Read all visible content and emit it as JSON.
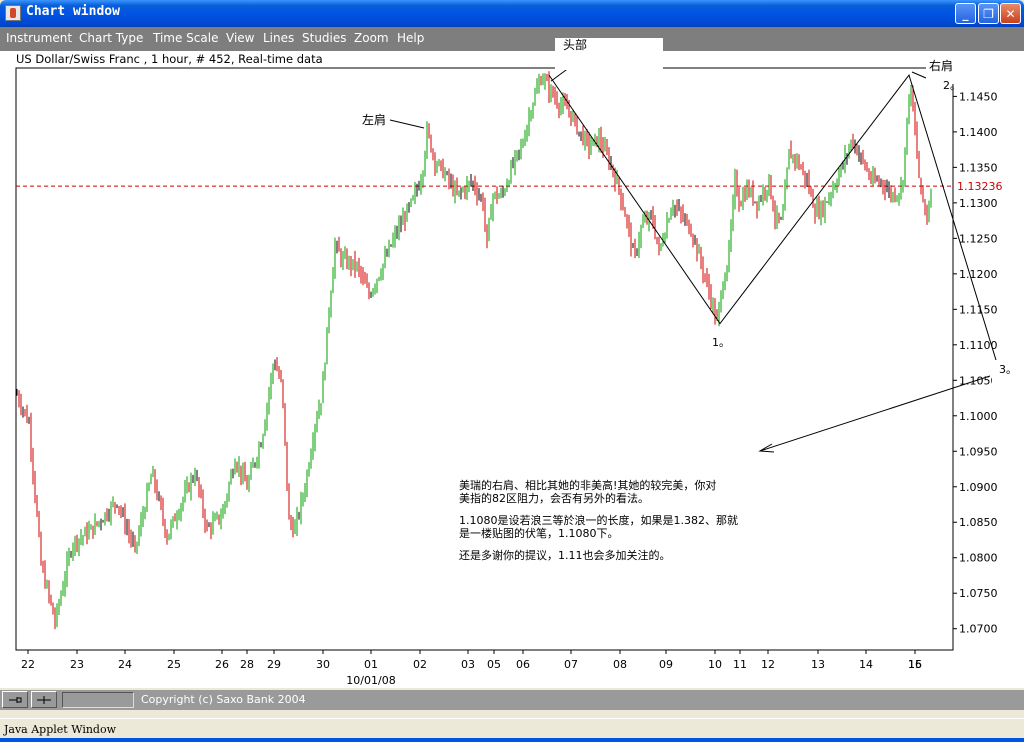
{
  "window": {
    "title": "Chart window",
    "buttons": [
      "_",
      "❐",
      "✕"
    ]
  },
  "menu": [
    "Instrument",
    "Chart Type",
    "Time Scale",
    "View",
    "Lines",
    "Studies",
    "Zoom",
    "Help"
  ],
  "chart_header": "US Dollar/Swiss Franc , 1 hour, # 452, Real-time data",
  "chart_data": {
    "type": "candlestick",
    "instrument": "US Dollar/Swiss Franc",
    "timeframe": "1 hour",
    "ylim": [
      1.067,
      1.149
    ],
    "y_ticks": [
      "1.1450",
      "1.1400",
      "1.1350",
      "1.1300",
      "1.1250",
      "1.1200",
      "1.1150",
      "1.1100",
      "1.1050",
      "1.1000",
      "1.0950",
      "1.0900",
      "1.0850",
      "1.0800",
      "1.0750",
      "1.0700"
    ],
    "x_ticks": [
      "22",
      "23",
      "24",
      "25",
      "26",
      "28",
      "29",
      "30",
      "01",
      "02",
      "03",
      "05",
      "06",
      "07",
      "08",
      "09",
      "10",
      "11",
      "12",
      "13",
      "14",
      "15",
      "16"
    ],
    "x_sub_label": "10/01/08",
    "current_price": 1.13236,
    "current_price_label": "1.13236",
    "path": [
      [
        0,
        1.103
      ],
      [
        12,
        1.099
      ],
      [
        24,
        1.079
      ],
      [
        38,
        1.071
      ],
      [
        55,
        1.082
      ],
      [
        75,
        1.084
      ],
      [
        100,
        1.088
      ],
      [
        118,
        1.081
      ],
      [
        135,
        1.092
      ],
      [
        150,
        1.083
      ],
      [
        165,
        1.088
      ],
      [
        178,
        1.092
      ],
      [
        190,
        1.084
      ],
      [
        205,
        1.086
      ],
      [
        218,
        1.094
      ],
      [
        230,
        1.09
      ],
      [
        245,
        1.097
      ],
      [
        257,
        1.108
      ],
      [
        265,
        1.104
      ],
      [
        272,
        1.085
      ],
      [
        278,
        1.084
      ],
      [
        288,
        1.09
      ],
      [
        298,
        1.099
      ],
      [
        305,
        1.103
      ],
      [
        312,
        1.115
      ],
      [
        318,
        1.124
      ],
      [
        325,
        1.122
      ],
      [
        340,
        1.121
      ],
      [
        352,
        1.117
      ],
      [
        365,
        1.121
      ],
      [
        380,
        1.126
      ],
      [
        395,
        1.13
      ],
      [
        405,
        1.134
      ],
      [
        410,
        1.14
      ],
      [
        418,
        1.136
      ],
      [
        428,
        1.134
      ],
      [
        440,
        1.131
      ],
      [
        455,
        1.133
      ],
      [
        466,
        1.13
      ],
      [
        470,
        1.124
      ],
      [
        475,
        1.131
      ],
      [
        485,
        1.131
      ],
      [
        495,
        1.135
      ],
      [
        505,
        1.138
      ],
      [
        515,
        1.144
      ],
      [
        525,
        1.148
      ],
      [
        532,
        1.146
      ],
      [
        542,
        1.144
      ],
      [
        552,
        1.143
      ],
      [
        562,
        1.14
      ],
      [
        572,
        1.138
      ],
      [
        582,
        1.139
      ],
      [
        592,
        1.136
      ],
      [
        602,
        1.132
      ],
      [
        612,
        1.126
      ],
      [
        617,
        1.122
      ],
      [
        625,
        1.127
      ],
      [
        635,
        1.128
      ],
      [
        642,
        1.123
      ],
      [
        655,
        1.13
      ],
      [
        665,
        1.128
      ],
      [
        675,
        1.126
      ],
      [
        685,
        1.121
      ],
      [
        695,
        1.116
      ],
      [
        700,
        1.113
      ],
      [
        705,
        1.118
      ],
      [
        712,
        1.123
      ],
      [
        718,
        1.133
      ],
      [
        723,
        1.13
      ],
      [
        730,
        1.132
      ],
      [
        740,
        1.13
      ],
      [
        752,
        1.133
      ],
      [
        758,
        1.128
      ],
      [
        765,
        1.127
      ],
      [
        772,
        1.137
      ],
      [
        780,
        1.136
      ],
      [
        790,
        1.133
      ],
      [
        798,
        1.129
      ],
      [
        805,
        1.129
      ],
      [
        812,
        1.131
      ],
      [
        825,
        1.135
      ],
      [
        835,
        1.139
      ],
      [
        845,
        1.136
      ],
      [
        855,
        1.133
      ],
      [
        865,
        1.133
      ],
      [
        875,
        1.131
      ],
      [
        885,
        1.132
      ],
      [
        893,
        1.147
      ],
      [
        898,
        1.14
      ],
      [
        903,
        1.132
      ],
      [
        910,
        1.128
      ],
      [
        915,
        1.133
      ]
    ]
  },
  "annotations": {
    "head": "头部",
    "left_shoulder": "左肩",
    "right_shoulder": "右肩",
    "point_1": "1。",
    "point_2": "2。",
    "point_3": "3。",
    "comment_lines": [
      "美瑞的右肩、相比其她的非美高!其她的较完美，你对",
      "美指的82区阻力，会否有另外的看法。",
      "1.1080是设若浪三等於浪一的长度，如果是1.382、那就",
      "是一楼贴图的伏笔，1.1080下。",
      "还是多谢你的提议，1.11也会多加关注的。"
    ]
  },
  "colors": {
    "up_bar": "#00a000",
    "down_bar": "#d00000",
    "neutral_bar": "#000000",
    "price_line": "#d00000",
    "titlebar": "#0054e3",
    "menubar": "#7e7e7e"
  },
  "status_bar": {
    "btn_1_icon": "pin-icon",
    "btn_2_icon": "crosshair-icon",
    "copyright": "Copyright (c) Saxo Bank 2004"
  },
  "applet_label": "Java Applet Window"
}
